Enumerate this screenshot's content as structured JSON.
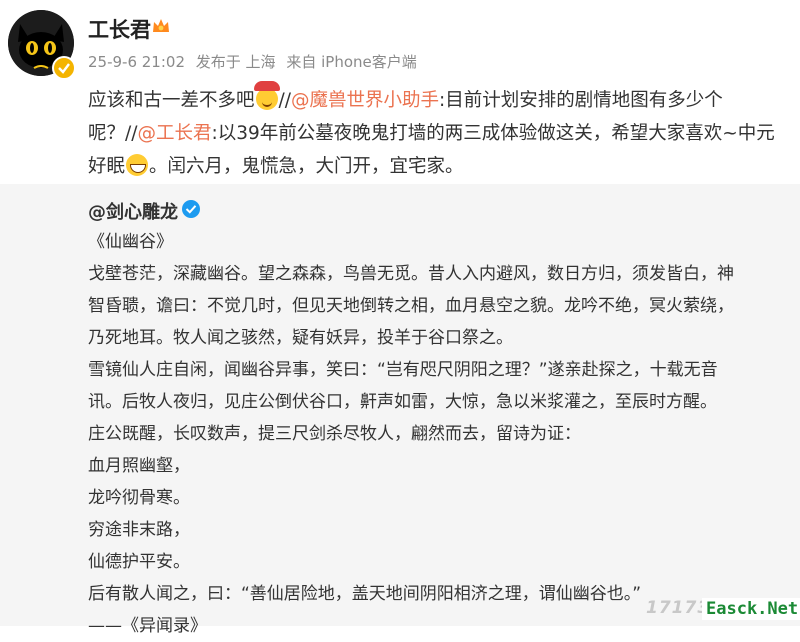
{
  "author": {
    "name": "工长君",
    "avatar_icon": "black-cat-avatar",
    "badge_icon": "verified-badge",
    "vip_icon": "vip-crown-icon"
  },
  "meta": {
    "datetime": "25-9-6 21:02",
    "published_label": "发布于 上海",
    "source": "来自 iPhone客户端"
  },
  "post": {
    "t1": "应该和古一差不多吧",
    "emoji1": "emoji-party-face",
    "t2": "//",
    "m1": "@魔兽世界小助手",
    "t3": ":目前计划安排的剧情地图有多少个呢？//",
    "m2": "@工长君",
    "t4": ":以39年前公墓夜晚鬼打墙的两三成体验做这关，希望大家喜欢~中元好眠",
    "emoji2": "emoji-grin-face",
    "t5": "。闰六月，鬼慌急，大门开，宜宅家。"
  },
  "repost": {
    "author": "@剑心雕龙",
    "verify_icon": "verified-blue-icon",
    "lines": [
      "《仙幽谷》",
      "戈壁苍茫，深藏幽谷。望之森森，鸟兽无觅。昔人入内避风，数日方归，须发皆白，神",
      "智昏聩，谵曰：不觉几时，但见天地倒转之相，血月悬空之貌。龙吟不绝，冥火萦绕，",
      "乃死地耳。牧人闻之骇然，疑有妖异，投羊于谷口祭之。",
      "雪镜仙人庄自闲，闻幽谷异事，笑曰：“岂有咫尺阴阳之理？”遂亲赴探之，十载无音",
      "讯。后牧人夜归，见庄公倒伏谷口，鼾声如雷，大惊，急以米浆灌之，至辰时方醒。",
      "庄公既醒，长叹数声，提三尺剑杀尽牧人，翩然而去，留诗为证：",
      "血月照幽壑，",
      "龙吟彻骨寒。",
      "穷途非末路，",
      "仙德护平安。",
      "后有散人闻之，曰：“善仙居险地，盖天地间阴阳相济之理，谓仙幽谷也。”",
      "——《异闻录》"
    ]
  },
  "watermarks": {
    "left": "17173",
    "right": "Easck.Net"
  },
  "colors": {
    "mention": "#eb7350",
    "repost_bg": "#f5f5f5",
    "meta_text": "#8a8a8a",
    "verify_gold": "#f4b400",
    "verify_blue": "#1d9bf0"
  }
}
